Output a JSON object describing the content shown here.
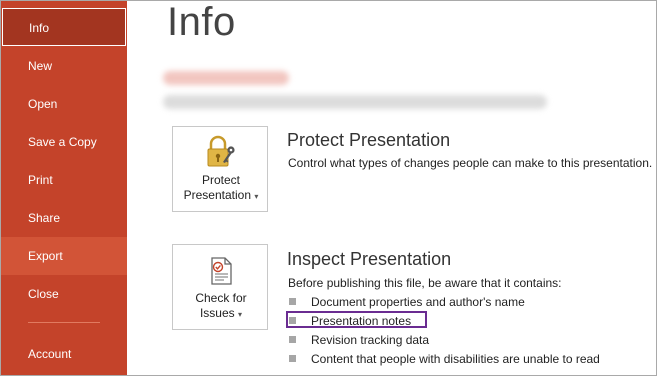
{
  "sidebar": {
    "items": [
      {
        "label": "Info"
      },
      {
        "label": "New"
      },
      {
        "label": "Open"
      },
      {
        "label": "Save a Copy"
      },
      {
        "label": "Print"
      },
      {
        "label": "Share"
      },
      {
        "label": "Export"
      },
      {
        "label": "Close"
      },
      {
        "label": "Account"
      }
    ],
    "selected": "Info",
    "hovered": "Export"
  },
  "main": {
    "title": "Info",
    "protect": {
      "tile_line1": "Protect",
      "tile_line2": "Presentation",
      "heading": "Protect Presentation",
      "description": "Control what types of changes people can make to this presentation."
    },
    "inspect": {
      "tile_line1": "Check for",
      "tile_line2": "Issues",
      "heading": "Inspect Presentation",
      "description": "Before publishing this file, be aware that it contains:",
      "bullets": [
        "Document properties and author's name",
        "Presentation notes",
        "Revision tracking data",
        "Content that people with disabilities are unable to read"
      ],
      "highlighted_bullet": "Presentation notes"
    }
  },
  "colors": {
    "sidebar": "#c4432a",
    "sidebar_selected": "#a33520",
    "highlight": "#6a2c91"
  },
  "icons": {
    "protect": "lock-key-icon",
    "inspect": "document-checklist-icon",
    "dropdown": "caret-down-icon"
  }
}
